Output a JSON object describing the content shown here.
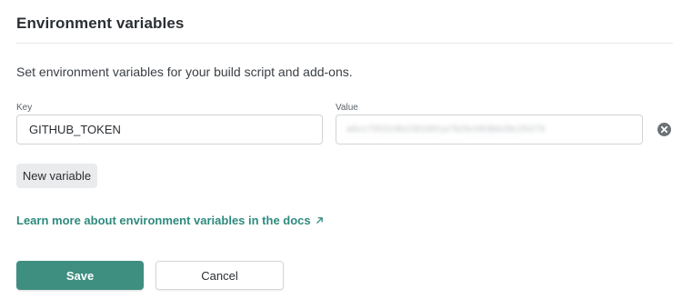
{
  "section": {
    "title": "Environment variables",
    "description": "Set environment variables for your build script and add-ons."
  },
  "variables": [
    {
      "key_label": "Key",
      "value_label": "Value",
      "key": "GITHUB_TOKEN",
      "value_blurred": "a6cc755319b2381891a7826c083bb28c25479"
    }
  ],
  "actions": {
    "new_variable": "New variable",
    "docs_link": "Learn more about environment variables in the docs",
    "save": "Save",
    "cancel": "Cancel"
  },
  "icons": {
    "remove": "close-circle-icon",
    "external_link": "arrow-up-right-icon"
  },
  "colors": {
    "accent": "#3f8f80",
    "link": "#2e8a7e",
    "remove_icon_bg": "#6d7277"
  }
}
